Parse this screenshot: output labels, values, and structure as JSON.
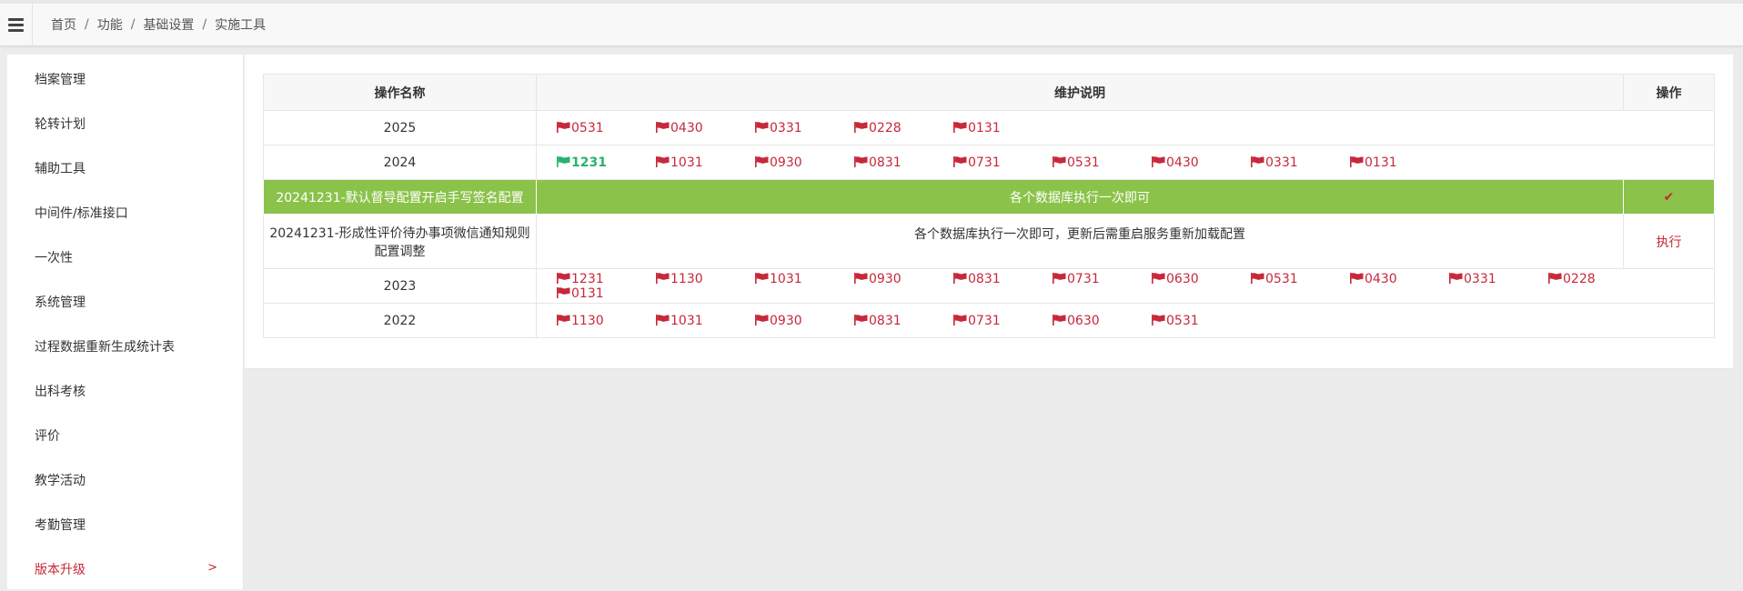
{
  "breadcrumb": [
    "首页",
    "功能",
    "基础设置",
    "实施工具"
  ],
  "sidebar": {
    "items": [
      {
        "label": "档案管理"
      },
      {
        "label": "轮转计划"
      },
      {
        "label": "辅助工具"
      },
      {
        "label": "中间件/标准接口"
      },
      {
        "label": "一次性"
      },
      {
        "label": "系统管理"
      },
      {
        "label": "过程数据重新生成统计表"
      },
      {
        "label": "出科考核"
      },
      {
        "label": "评价"
      },
      {
        "label": "教学活动"
      },
      {
        "label": "考勤管理"
      },
      {
        "label": "版本升级",
        "active": true
      }
    ]
  },
  "table": {
    "headers": [
      "操作名称",
      "维护说明",
      "操作"
    ],
    "rows": [
      {
        "name": "2025",
        "type": "versions",
        "versions": [
          "0531",
          "0430",
          "0331",
          "0228",
          "0131"
        ]
      },
      {
        "name": "2024",
        "type": "versions",
        "current": "1231",
        "versions": [
          "1231",
          "1031",
          "0930",
          "0831",
          "0731",
          "0531",
          "0430",
          "0331",
          "0131"
        ]
      },
      {
        "name": "20241231-默认督导配置开启手写签名配置",
        "type": "task",
        "highlight": true,
        "desc": "各个数据库执行一次即可",
        "op_icon": "check-icon"
      },
      {
        "name": "20241231-形成性评价待办事项微信通知规则配置调整",
        "type": "task",
        "desc": "各个数据库执行一次即可，更新后需重启服务重新加载配置",
        "op": "执行"
      },
      {
        "name": "2023",
        "type": "versions",
        "versions": [
          "1231",
          "1130",
          "1031",
          "0930",
          "0831",
          "0731",
          "0630",
          "0531",
          "0430",
          "0331",
          "0228",
          "0131"
        ]
      },
      {
        "name": "2022",
        "type": "versions",
        "versions": [
          "1130",
          "1031",
          "0930",
          "0831",
          "0731",
          "0630",
          "0531"
        ]
      }
    ]
  },
  "colors": {
    "accent_red": "#c7283a",
    "current_green": "#27b36c",
    "highlight_row": "#8bc34a"
  }
}
